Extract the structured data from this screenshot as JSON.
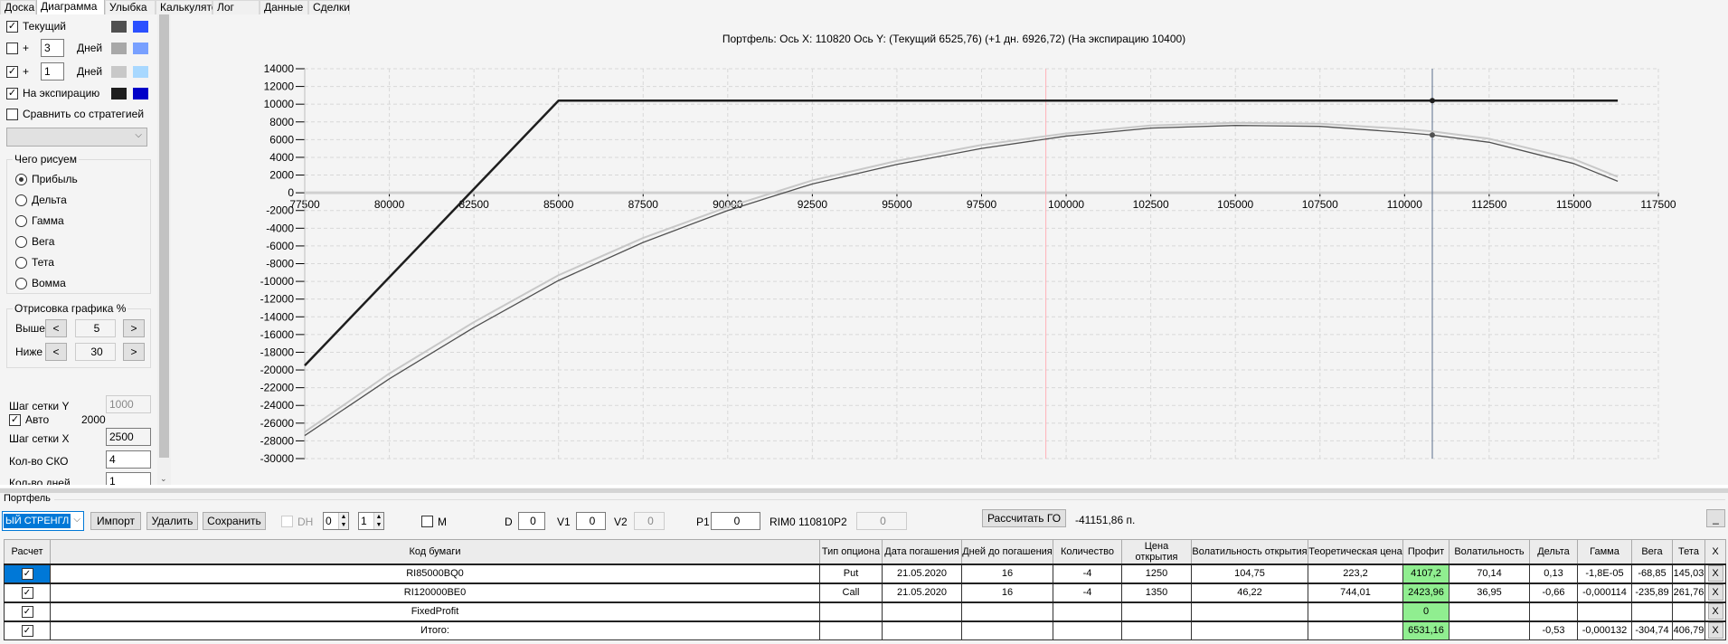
{
  "tabs": [
    {
      "label": "Доска"
    },
    {
      "label": "Диаграмма",
      "active": true
    },
    {
      "label": "Улыбка"
    },
    {
      "label": "Калькулятор"
    },
    {
      "label": "Лог"
    },
    {
      "label": "Данные"
    },
    {
      "label": "Сделки"
    }
  ],
  "left": {
    "current": {
      "label": "Текущий",
      "checked": true,
      "colors": [
        "#505050",
        "#2b50ff"
      ]
    },
    "plus3": {
      "plus": "+",
      "days": "3",
      "unit": "Дней",
      "checked": false,
      "colors": [
        "#a8a8a8",
        "#78a0ff"
      ]
    },
    "plus1": {
      "plus": "+",
      "days": "1",
      "unit": "Дней",
      "checked": true,
      "colors": [
        "#c8c8c8",
        "#a8d8ff"
      ]
    },
    "expiration": {
      "label": "На экспирацию",
      "checked": true,
      "colors": [
        "#1e1e1e",
        "#0000c8"
      ]
    },
    "compare": {
      "label": "Сравнить со стратегией",
      "checked": false
    },
    "draw_group": {
      "title": "Чего рисуем",
      "options": [
        "Прибыль",
        "Дельта",
        "Гамма",
        "Вега",
        "Тета",
        "Вомма"
      ],
      "selected": "Прибыль"
    },
    "render_group": {
      "title": "Отрисовка графика %",
      "above_label": "Выше",
      "above": "5",
      "below_label": "Ниже",
      "below": "30",
      "prev": "<",
      "next": ">"
    },
    "grid_y": {
      "label": "Шаг сетки Y",
      "value": "1000"
    },
    "auto": {
      "label": "Авто",
      "checked": true,
      "value": "2000"
    },
    "grid_x": {
      "label": "Шаг сетки X",
      "value": "2500"
    },
    "sko": {
      "label": "Кол-во СКО",
      "value": "4"
    },
    "days": {
      "label": "Кол-во дней",
      "value": "1"
    }
  },
  "chart_title": "Портфель: Ось X: 110820 Ось Y:  (Текущий 6525,76)  (+1 дн. 6926,72)  (На экспирацию 10400)",
  "chart_data": {
    "type": "line",
    "xlim": [
      77500,
      117500
    ],
    "ylim": [
      -30000,
      14000
    ],
    "xticks": [
      77500,
      80000,
      82500,
      85000,
      87500,
      90000,
      92500,
      95000,
      97500,
      100000,
      102500,
      105000,
      107500,
      110000,
      112500,
      115000,
      117500
    ],
    "yticks": [
      14000,
      12000,
      10000,
      8000,
      6000,
      4000,
      2000,
      0,
      -2000,
      -4000,
      -6000,
      -8000,
      -10000,
      -12000,
      -14000,
      -16000,
      -18000,
      -20000,
      -22000,
      -24000,
      -26000,
      -28000,
      -30000
    ],
    "grid": true,
    "markers": {
      "red_line_x": 99400,
      "cursor_x": 110820
    },
    "series": [
      {
        "key": "plus1",
        "color": "#c8c8c8",
        "x": [
          77500,
          80000,
          82500,
          85000,
          87500,
          90000,
          92500,
          95000,
          97500,
          100000,
          102500,
          105000,
          107500,
          110000,
          110820,
          112500,
          115000,
          116300
        ],
        "y": [
          -27000,
          -20400,
          -14600,
          -9300,
          -5100,
          -1600,
          1400,
          3600,
          5400,
          6700,
          7600,
          7900,
          7800,
          7200,
          6927,
          6100,
          3800,
          1800
        ]
      },
      {
        "key": "current",
        "color": "#505050",
        "x": [
          77500,
          80000,
          82500,
          85000,
          87500,
          90000,
          92500,
          95000,
          97500,
          100000,
          102500,
          105000,
          107500,
          110000,
          110820,
          112500,
          115000,
          116300
        ],
        "y": [
          -27400,
          -21000,
          -15200,
          -9900,
          -5600,
          -2000,
          1000,
          3200,
          5000,
          6400,
          7300,
          7600,
          7500,
          6800,
          6526,
          5700,
          3300,
          1300
        ]
      },
      {
        "key": "expiration",
        "color": "#1e1e1e",
        "x": [
          77500,
          85000,
          116300
        ],
        "y": [
          -19500,
          10400,
          10400
        ]
      }
    ]
  },
  "portfolio": {
    "title": "Портфель",
    "strategy": "ЫЙ СТРЕНГЛ",
    "import": "Импорт",
    "delete": "Удалить",
    "save": "Сохранить",
    "dh_label": "DH",
    "spin1": "0",
    "spin2": "1",
    "m_label": "M",
    "d_label": "D",
    "d": "0",
    "v1_label": "V1",
    "v1": "0",
    "v2_label": "V2",
    "v2": "0",
    "p1_label": "P1",
    "p1": "0",
    "rim": "RIM0 110810",
    "p2_label": "P2",
    "p2": "0",
    "calc_go": "Рассчитать ГО",
    "go_value": "-41151,86 п.",
    "minimize": "_"
  },
  "table": {
    "headers": [
      "Расчет",
      "Код бумаги",
      "Тип опциона",
      "Дата погашения",
      "Дней до погашения",
      "Количество",
      "Цена открытия",
      "Волатильность открытия",
      "Теоретическая цена",
      "Профит",
      "Волатильность",
      "Дельта",
      "Гамма",
      "Вега",
      "Тета",
      "X"
    ],
    "rows": [
      [
        "✓",
        "RI85000BQ0",
        "Put",
        "21.05.2020",
        "16",
        "-4",
        "1250",
        "104,75",
        "223,2",
        "4107,2",
        "70,14",
        "0,13",
        "-1,8E-05",
        "-68,85",
        "145,03",
        "X"
      ],
      [
        "✓",
        "RI120000BE0",
        "Call",
        "21.05.2020",
        "16",
        "-4",
        "1350",
        "46,22",
        "744,01",
        "2423,96",
        "36,95",
        "-0,66",
        "-0,000114",
        "-235,89",
        "261,76",
        "X"
      ],
      [
        "✓",
        "FixedProfit",
        "",
        "",
        "",
        "",
        "",
        "",
        "",
        "0",
        "",
        "",
        "",
        "",
        "",
        "X"
      ],
      [
        "✓",
        "Итого:",
        "",
        "",
        "",
        "",
        "",
        "",
        "",
        "6531,16",
        "",
        "-0,53",
        "-0,000132",
        "-304,74",
        "406,79",
        "X"
      ]
    ]
  }
}
